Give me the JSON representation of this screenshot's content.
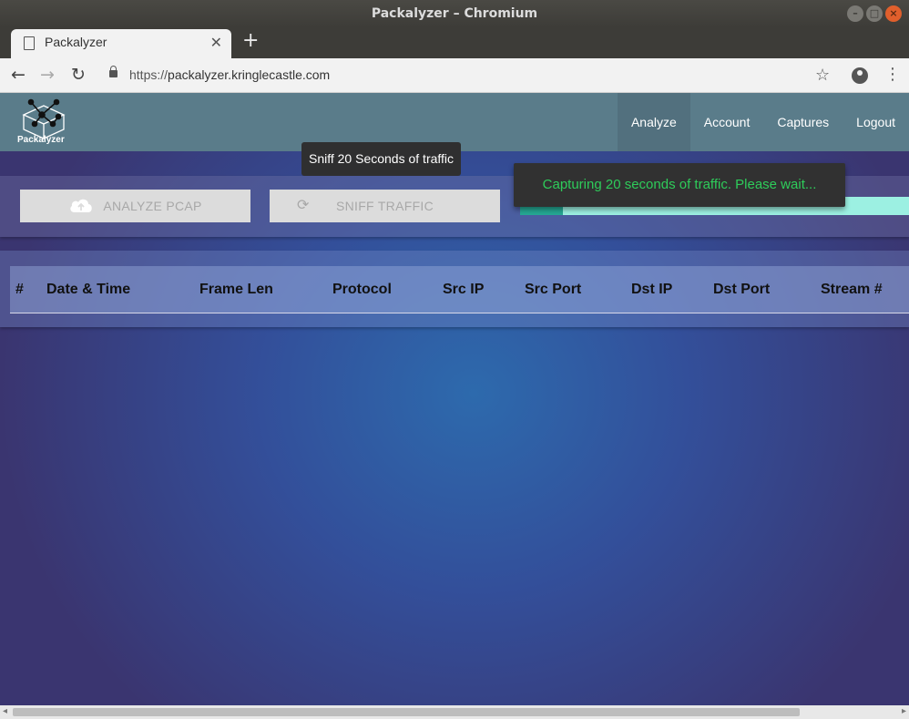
{
  "window": {
    "title": "Packalyzer – Chromium"
  },
  "browser": {
    "tab_title": "Packalyzer",
    "url_scheme": "https://",
    "url_host": "packalyzer.kringlecastle.com"
  },
  "app": {
    "logo_text": "Packalyzer",
    "nav": [
      "Analyze",
      "Account",
      "Captures",
      "Logout"
    ],
    "tooltip": "Sniff 20 Seconds of traffic",
    "buttons": {
      "analyze": "ANALYZE PCAP",
      "sniff": "SNIFF TRAFFIC"
    },
    "snackbar": "Capturing 20 seconds of traffic. Please wait...",
    "progress_fraction": 0.11,
    "colors": {
      "snackbar_text": "#2ecc5a",
      "progress_fill": "#25a893",
      "progress_track": "#9cf0e2"
    },
    "table": {
      "headers": [
        "#",
        "Date & Time",
        "Frame Len",
        "Protocol",
        "Src IP",
        "Src Port",
        "Dst IP",
        "Dst Port",
        "Stream #"
      ]
    }
  }
}
